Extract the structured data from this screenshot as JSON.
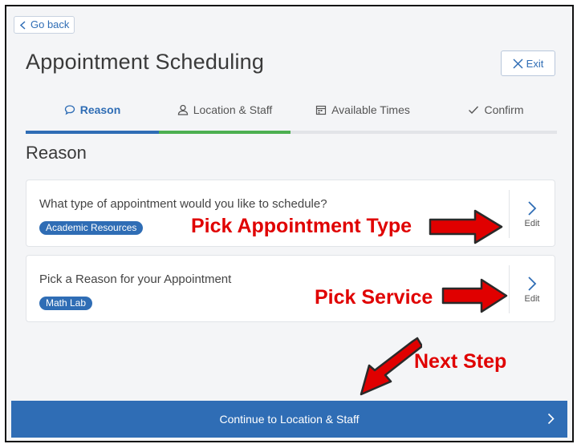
{
  "nav": {
    "go_back": "Go back",
    "exit": "Exit"
  },
  "header": {
    "title": "Appointment Scheduling"
  },
  "steps": [
    {
      "label": "Reason",
      "icon": "speech-bubble-icon",
      "state": "active",
      "color": "#2f6db5"
    },
    {
      "label": "Location & Staff",
      "icon": "person-icon",
      "state": "next",
      "color": "#4caf50"
    },
    {
      "label": "Available Times",
      "icon": "calendar-icon",
      "state": "inactive"
    },
    {
      "label": "Confirm",
      "icon": "checkmark-icon",
      "state": "inactive"
    }
  ],
  "section": {
    "heading": "Reason"
  },
  "cards": [
    {
      "question": "What type of appointment would you like to schedule?",
      "selected": "Academic Resources",
      "edit": "Edit"
    },
    {
      "question": "Pick a Reason for your Appointment",
      "selected": "Math Lab",
      "edit": "Edit"
    }
  ],
  "annotations": {
    "pick_type": "Pick Appointment Type",
    "pick_service": "Pick Service",
    "next_step": "Next Step",
    "color": "#e00000"
  },
  "footer": {
    "continue": "Continue to Location & Staff"
  },
  "colors": {
    "primary": "#2f6db5",
    "progress_green": "#4caf50",
    "background": "#f4f5f7"
  }
}
